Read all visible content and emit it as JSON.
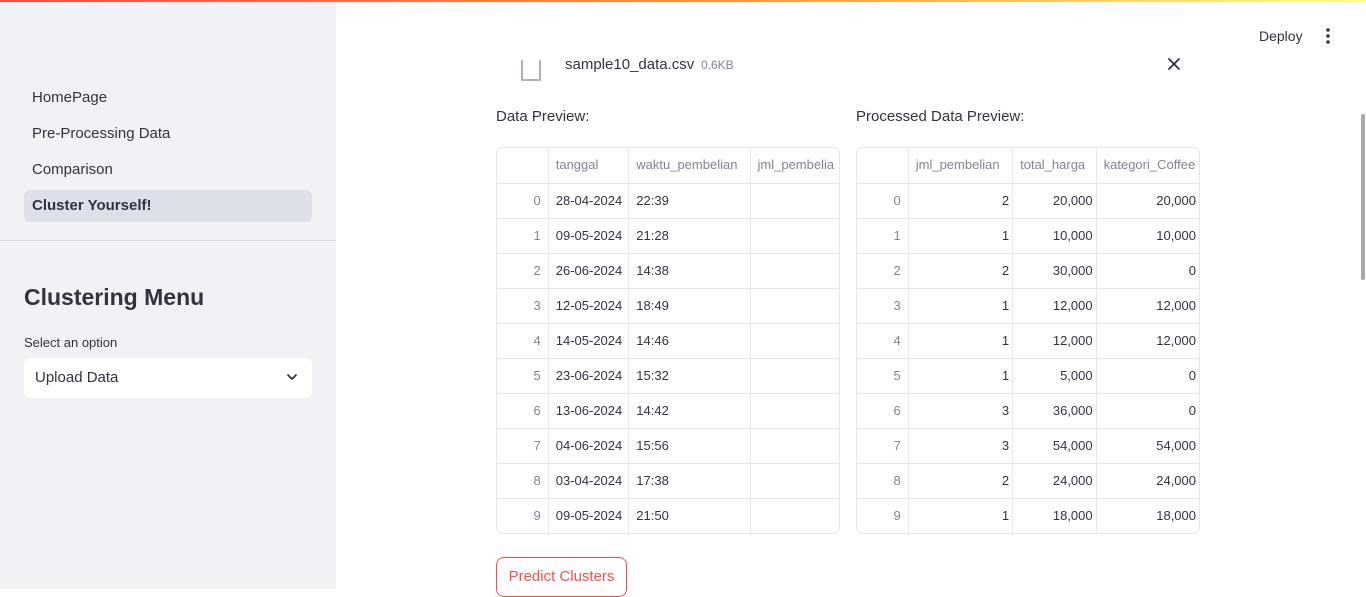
{
  "sidebar": {
    "nav": [
      {
        "label": "HomePage",
        "active": false
      },
      {
        "label": "Pre-Processing Data",
        "active": false
      },
      {
        "label": "Comparison",
        "active": false
      },
      {
        "label": "Cluster Yourself!",
        "active": true
      }
    ],
    "menu_title": "Clustering Menu",
    "select_label": "Select an option",
    "select_value": "Upload Data"
  },
  "header": {
    "deploy_label": "Deploy"
  },
  "file": {
    "name": "sample10_data.csv",
    "size": "0.6KB"
  },
  "data_preview": {
    "title": "Data Preview:",
    "columns": [
      "",
      "tanggal",
      "waktu_pembelian",
      "jml_pembelia"
    ],
    "rows": [
      [
        "0",
        "28-04-2024",
        "22:39",
        ""
      ],
      [
        "1",
        "09-05-2024",
        "21:28",
        ""
      ],
      [
        "2",
        "26-06-2024",
        "14:38",
        ""
      ],
      [
        "3",
        "12-05-2024",
        "18:49",
        ""
      ],
      [
        "4",
        "14-05-2024",
        "14:46",
        ""
      ],
      [
        "5",
        "23-06-2024",
        "15:32",
        ""
      ],
      [
        "6",
        "13-06-2024",
        "14:42",
        ""
      ],
      [
        "7",
        "04-06-2024",
        "15:56",
        ""
      ],
      [
        "8",
        "03-04-2024",
        "17:38",
        ""
      ],
      [
        "9",
        "09-05-2024",
        "21:50",
        ""
      ]
    ]
  },
  "processed_preview": {
    "title": "Processed Data Preview:",
    "columns": [
      "",
      "jml_pembelian",
      "total_harga",
      "kategori_Coffee"
    ],
    "rows": [
      [
        "0",
        "2",
        "20,000",
        "20,000"
      ],
      [
        "1",
        "1",
        "10,000",
        "10,000"
      ],
      [
        "2",
        "2",
        "30,000",
        "0"
      ],
      [
        "3",
        "1",
        "12,000",
        "12,000"
      ],
      [
        "4",
        "1",
        "12,000",
        "12,000"
      ],
      [
        "5",
        "1",
        "5,000",
        "0"
      ],
      [
        "6",
        "3",
        "36,000",
        "0"
      ],
      [
        "7",
        "3",
        "54,000",
        "54,000"
      ],
      [
        "8",
        "2",
        "24,000",
        "24,000"
      ],
      [
        "9",
        "1",
        "18,000",
        "18,000"
      ]
    ]
  },
  "predict_label": "Predict Clusters",
  "colors": {
    "accent": "#ff4b4b",
    "sidebar_bg": "#f0f2f6",
    "active_item_bg": "#dde0e8"
  }
}
